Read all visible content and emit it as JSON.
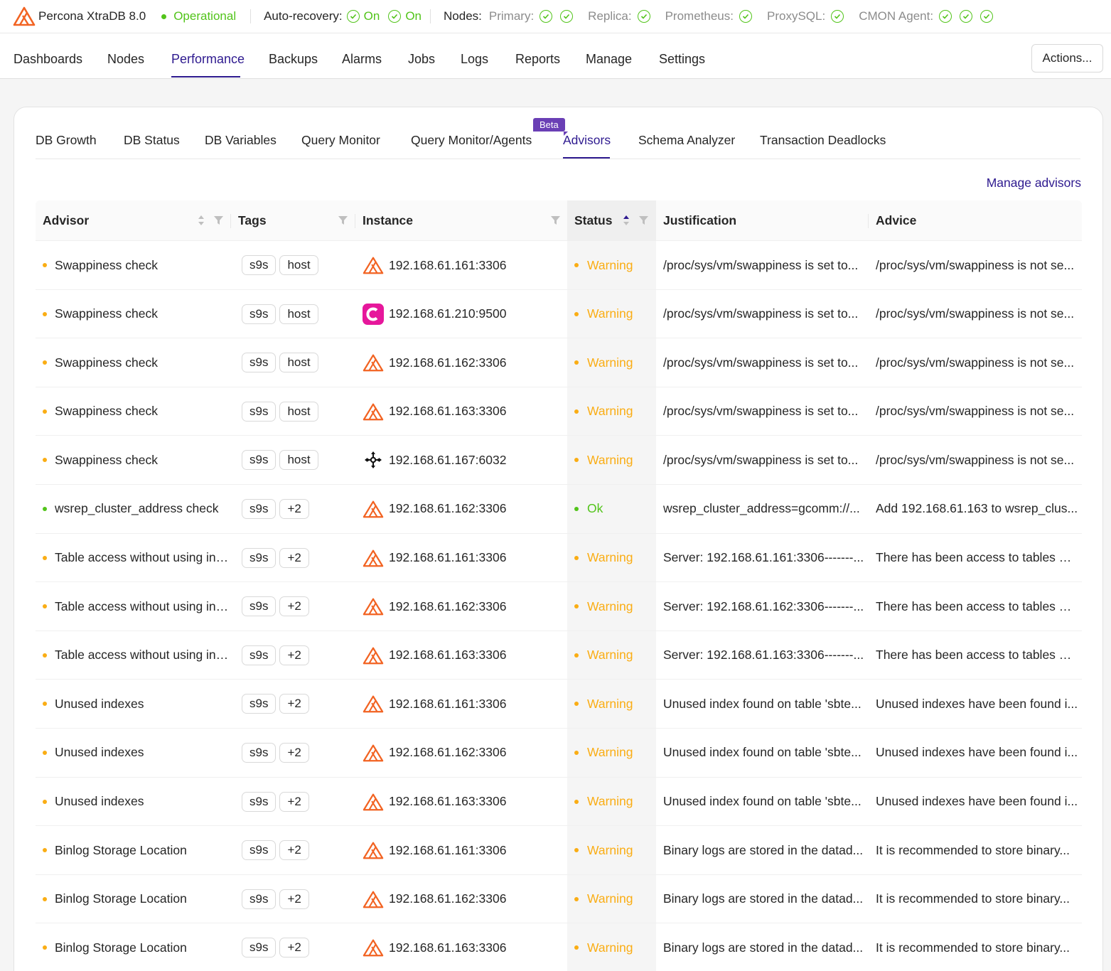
{
  "topbar": {
    "cluster_name": "Percona XtraDB 8.0",
    "state": "Operational",
    "auto_recovery_label": "Auto-recovery:",
    "cluster_recovery": "On",
    "node_recovery": "On",
    "nodes_label": "Nodes:",
    "node_groups": [
      {
        "label": "Primary:",
        "count": 2
      },
      {
        "label": "Replica:",
        "count": 1
      },
      {
        "label": "Prometheus:",
        "count": 1
      },
      {
        "label": "ProxySQL:",
        "count": 1
      },
      {
        "label": "CMON Agent:",
        "count": 3
      }
    ]
  },
  "nav": {
    "items": [
      "Dashboards",
      "Nodes",
      "Performance",
      "Backups",
      "Alarms",
      "Jobs",
      "Logs",
      "Reports",
      "Manage",
      "Settings"
    ],
    "active": "Performance",
    "actions_label": "Actions..."
  },
  "subtabs": {
    "items": [
      "DB Growth",
      "DB Status",
      "DB Variables",
      "Query Monitor",
      "Query Monitor/Agents",
      "Advisors",
      "Schema Analyzer",
      "Transaction Deadlocks"
    ],
    "active": "Advisors",
    "beta_label": "Beta"
  },
  "manage_advisors_label": "Manage advisors",
  "table": {
    "columns": [
      "Advisor",
      "Tags",
      "Instance",
      "Status",
      "Justification",
      "Advice"
    ],
    "rows": [
      {
        "advisor": "Swappiness check",
        "tags": [
          "s9s",
          "host"
        ],
        "icon": "percona-icon",
        "instance": "192.168.61.161:3306",
        "status": "Warning",
        "justification": "/proc/sys/vm/swappiness is set to...",
        "advice": "/proc/sys/vm/swappiness is not se..."
      },
      {
        "advisor": "Swappiness check",
        "tags": [
          "s9s",
          "host"
        ],
        "icon": "cmon-icon",
        "instance": "192.168.61.210:9500",
        "status": "Warning",
        "justification": "/proc/sys/vm/swappiness is set to...",
        "advice": "/proc/sys/vm/swappiness is not se..."
      },
      {
        "advisor": "Swappiness check",
        "tags": [
          "s9s",
          "host"
        ],
        "icon": "percona-icon",
        "instance": "192.168.61.162:3306",
        "status": "Warning",
        "justification": "/proc/sys/vm/swappiness is set to...",
        "advice": "/proc/sys/vm/swappiness is not se..."
      },
      {
        "advisor": "Swappiness check",
        "tags": [
          "s9s",
          "host"
        ],
        "icon": "percona-icon",
        "instance": "192.168.61.163:3306",
        "status": "Warning",
        "justification": "/proc/sys/vm/swappiness is set to...",
        "advice": "/proc/sys/vm/swappiness is not se..."
      },
      {
        "advisor": "Swappiness check",
        "tags": [
          "s9s",
          "host"
        ],
        "icon": "proxysql-icon",
        "instance": "192.168.61.167:6032",
        "status": "Warning",
        "justification": "/proc/sys/vm/swappiness is set to...",
        "advice": "/proc/sys/vm/swappiness is not se..."
      },
      {
        "advisor": "wsrep_cluster_address check",
        "tags": [
          "s9s",
          "+2"
        ],
        "icon": "percona-icon",
        "instance": "192.168.61.162:3306",
        "status": "Ok",
        "justification": "wsrep_cluster_address=gcomm://...",
        "advice": "Add 192.168.61.163 to wsrep_clus..."
      },
      {
        "advisor": "Table access without using index",
        "tags": [
          "s9s",
          "+2"
        ],
        "icon": "percona-icon",
        "instance": "192.168.61.161:3306",
        "status": "Warning",
        "justification": "Server: 192.168.61.161:3306-------...",
        "advice": "There has been access to tables wi..."
      },
      {
        "advisor": "Table access without using index",
        "tags": [
          "s9s",
          "+2"
        ],
        "icon": "percona-icon",
        "instance": "192.168.61.162:3306",
        "status": "Warning",
        "justification": "Server: 192.168.61.162:3306-------...",
        "advice": "There has been access to tables wi..."
      },
      {
        "advisor": "Table access without using index",
        "tags": [
          "s9s",
          "+2"
        ],
        "icon": "percona-icon",
        "instance": "192.168.61.163:3306",
        "status": "Warning",
        "justification": "Server: 192.168.61.163:3306-------...",
        "advice": "There has been access to tables wi..."
      },
      {
        "advisor": "Unused indexes",
        "tags": [
          "s9s",
          "+2"
        ],
        "icon": "percona-icon",
        "instance": "192.168.61.161:3306",
        "status": "Warning",
        "justification": "Unused index found on table 'sbte...",
        "advice": "Unused indexes have been found i..."
      },
      {
        "advisor": "Unused indexes",
        "tags": [
          "s9s",
          "+2"
        ],
        "icon": "percona-icon",
        "instance": "192.168.61.162:3306",
        "status": "Warning",
        "justification": "Unused index found on table 'sbte...",
        "advice": "Unused indexes have been found i..."
      },
      {
        "advisor": "Unused indexes",
        "tags": [
          "s9s",
          "+2"
        ],
        "icon": "percona-icon",
        "instance": "192.168.61.163:3306",
        "status": "Warning",
        "justification": "Unused index found on table 'sbte...",
        "advice": "Unused indexes have been found i..."
      },
      {
        "advisor": "Binlog Storage Location",
        "tags": [
          "s9s",
          "+2"
        ],
        "icon": "percona-icon",
        "instance": "192.168.61.161:3306",
        "status": "Warning",
        "justification": "Binary logs are stored in the datad...",
        "advice": "It is recommended to store binary..."
      },
      {
        "advisor": "Binlog Storage Location",
        "tags": [
          "s9s",
          "+2"
        ],
        "icon": "percona-icon",
        "instance": "192.168.61.162:3306",
        "status": "Warning",
        "justification": "Binary logs are stored in the datad...",
        "advice": "It is recommended to store binary..."
      },
      {
        "advisor": "Binlog Storage Location",
        "tags": [
          "s9s",
          "+2"
        ],
        "icon": "percona-icon",
        "instance": "192.168.61.163:3306",
        "status": "Warning",
        "justification": "Binary logs are stored in the datad...",
        "advice": "It is recommended to store binary..."
      }
    ]
  },
  "colors": {
    "accent": "#2e1a8f",
    "ok": "#52c41a",
    "warning": "#faad14",
    "percona_orange": "#f26322",
    "cmon_magenta": "#e6179b"
  }
}
